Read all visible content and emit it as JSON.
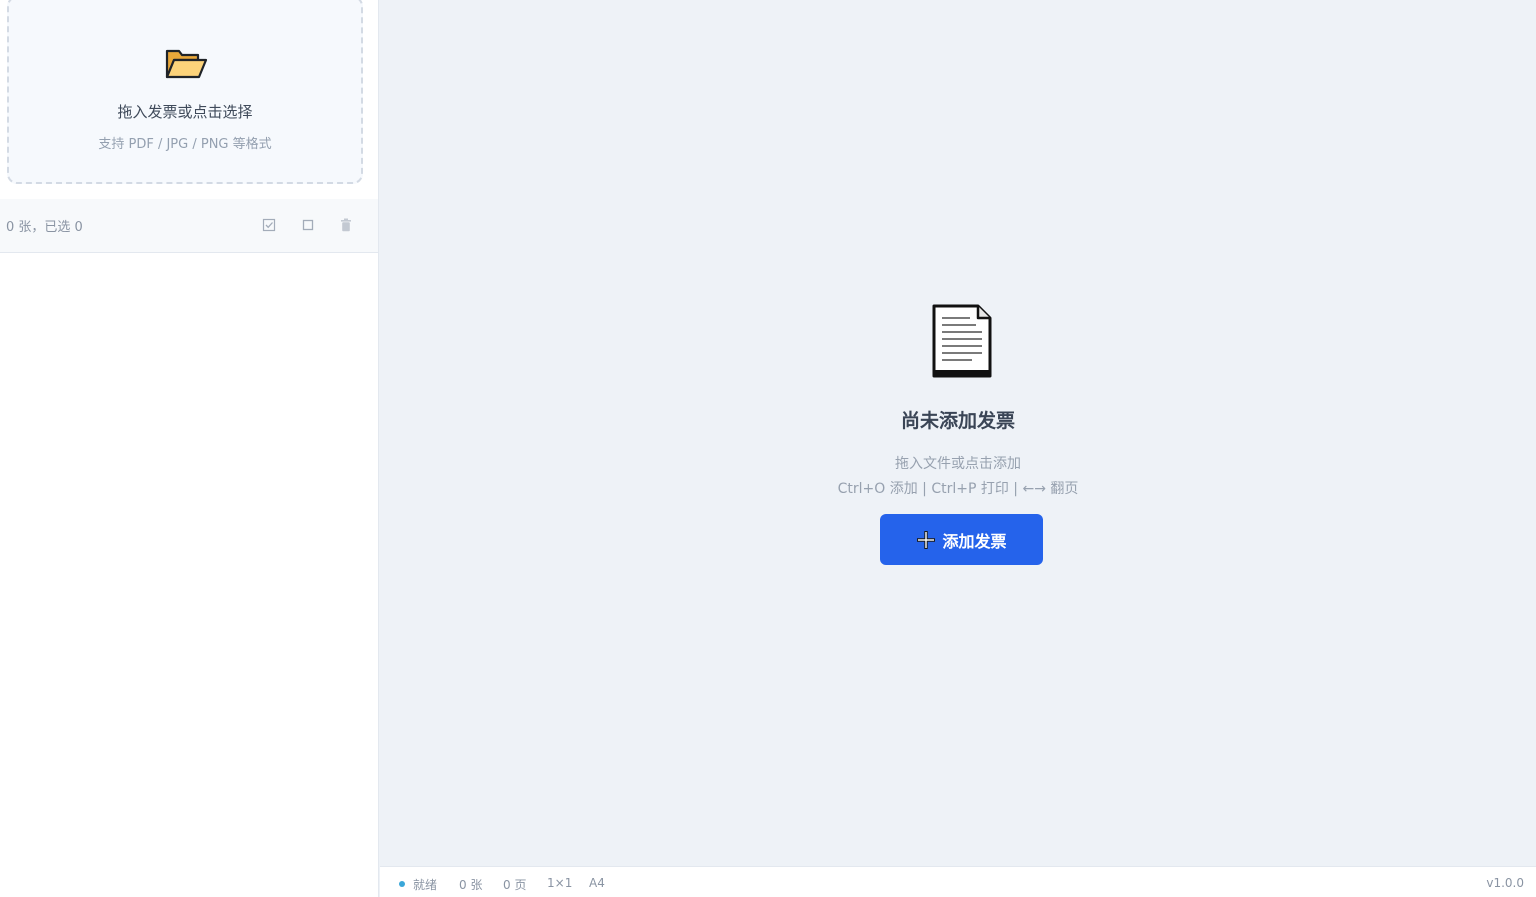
{
  "dropzone": {
    "icon": "folder-open-icon",
    "title": "拖入发票或点击选择",
    "subtitle": "支持 PDF / JPG / PNG 等格式"
  },
  "list_toolbar": {
    "count_text": "0 张，已选 0",
    "buttons": [
      {
        "name": "select-all",
        "icon": "checked-box-icon"
      },
      {
        "name": "deselect-all",
        "icon": "empty-square-icon"
      },
      {
        "name": "delete",
        "icon": "trash-icon"
      }
    ]
  },
  "empty_state": {
    "icon": "document-icon",
    "title": "尚未添加发票",
    "hint": "拖入文件或点击添加",
    "shortcuts": "Ctrl+O 添加 | Ctrl+P 打印 | ←→ 翻页",
    "add_button_label": "添加发票"
  },
  "statusbar": {
    "status": "就绪",
    "count": "0 张",
    "pages": "0 页",
    "layout": "1×1",
    "paper": "A4",
    "version": "v1.0.0"
  },
  "colors": {
    "accent": "#2563eb",
    "status_dot": "#3aa7d9",
    "background": "#eef2f7"
  }
}
